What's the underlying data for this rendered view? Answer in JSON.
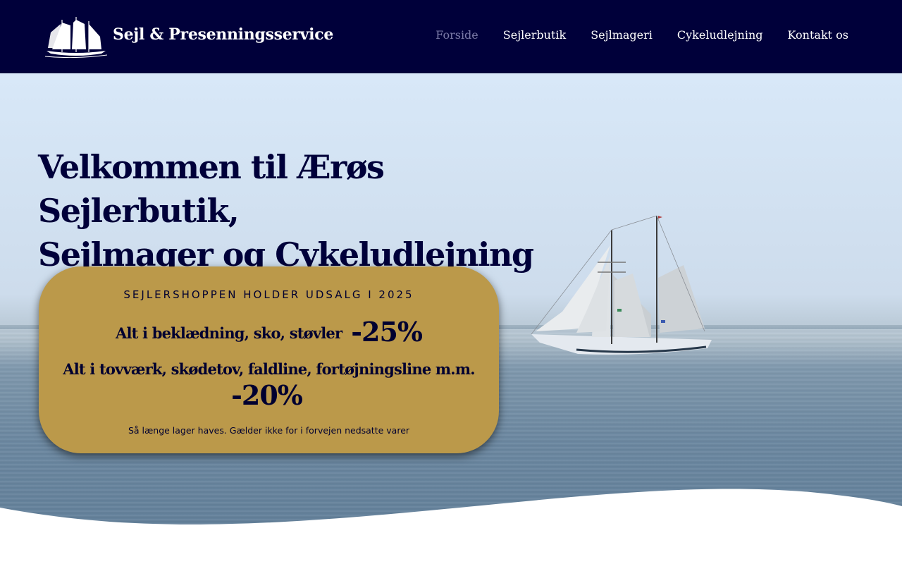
{
  "header": {
    "brand": "Sejl & Presenningsservice",
    "logo_icon": "sailing-ship-logo",
    "nav": [
      {
        "label": "Forside",
        "active": true
      },
      {
        "label": "Sejlerbutik",
        "active": false
      },
      {
        "label": "Sejlmageri",
        "active": false
      },
      {
        "label": "Cykeludlejning",
        "active": false
      },
      {
        "label": "Kontakt os",
        "active": false
      }
    ]
  },
  "hero": {
    "title_line1": "Velkommen til Ærøs Sejlerbutik,",
    "title_line2": "Sejlmager og Cykeludlejning"
  },
  "promo": {
    "heading": "SEJLERSHOPPEN HOLDER UDSALG I 2025",
    "line1_text": "Alt i beklædning, sko, støvler",
    "line1_discount": "-25%",
    "line2_text": "Alt i tovværk, skødetov, faldline, fortøjningsline m.m.",
    "line2_discount": "-20%",
    "note": "Så længe lager haves. Gælder ikke for i forvejen nedsatte varer"
  },
  "colors": {
    "header_bg": "#00003a",
    "nav_active": "#7b7ba8",
    "promo_bg": "#bb994a",
    "title_color": "#00003a"
  }
}
